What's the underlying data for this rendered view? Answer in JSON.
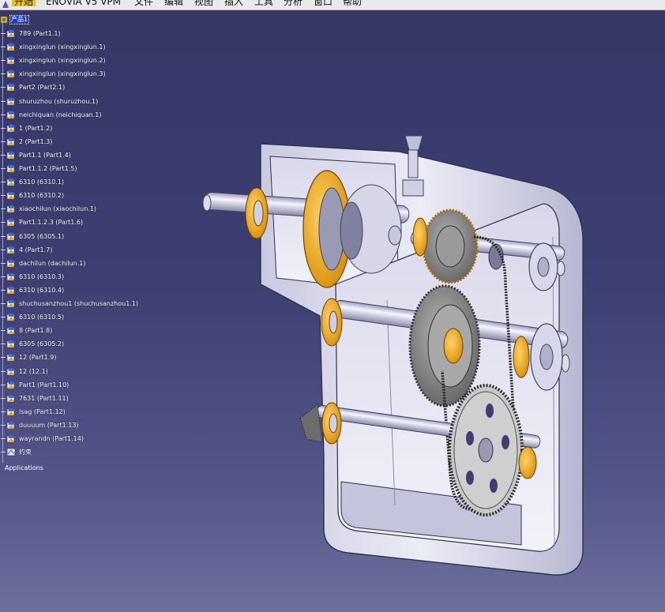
{
  "menubar": {
    "items": [
      {
        "label": "开始",
        "active": true
      },
      {
        "label": "ENOVIA V5 VPM"
      },
      {
        "label": "文件"
      },
      {
        "label": "编辑"
      },
      {
        "label": "视图"
      },
      {
        "label": "插入"
      },
      {
        "label": "工具"
      },
      {
        "label": "分析"
      },
      {
        "label": "窗口"
      },
      {
        "label": "帮助"
      }
    ],
    "active_color": "#f2c700"
  },
  "tree": {
    "root_label": "产品1",
    "items": [
      "789 (Part1.1)",
      "xingxinglun (xingxinglun.1)",
      "xingxinglun (xingxinglun.2)",
      "xingxinglun (xingxinglun.3)",
      "Part2 (Part2.1)",
      "shuruzhou (shuruzhou.1)",
      "neichiquan (neichiquan.1)",
      "1 (Part1.2)",
      "2 (Part1.3)",
      "Part1.1 (Part1.4)",
      "Part1.1.2 (Part1.5)",
      "6310 (6310.1)",
      "6310 (6310.2)",
      "xiaochilun (xiaochilun.1)",
      "Part1.1.2.3 (Part1.6)",
      "6305 (6305.1)",
      "4 (Part1.7)",
      "dachilun (dachilun.1)",
      "6310 (6310.3)",
      "6310 (6310.4)",
      "shuchusanzhou1 (shuchusanzhou1.1)",
      "6310 (6310.5)",
      "8 (Part1.8)",
      "6305 (6305.2)",
      "12 (Part1.9)",
      "12 (12.1)",
      "Part1 (Part1.10)",
      "7631 (Part1.11)",
      "lsag (Part1.12)",
      "duuuum (Part1.13)",
      "wayrandn (Part1.14)"
    ],
    "constraints_label": "约束",
    "applications_label": "Applications",
    "text_color": "#ffffff",
    "selection_color": "#1c3bd6"
  },
  "viewport": {
    "background_top": "#353766",
    "background_bottom": "#6e709e",
    "model": {
      "housing_color": "#dcdced",
      "bearing_color": "#f0a000",
      "gear_color": "#8a8a8a",
      "shaft_color": "#d8d8e8"
    }
  }
}
